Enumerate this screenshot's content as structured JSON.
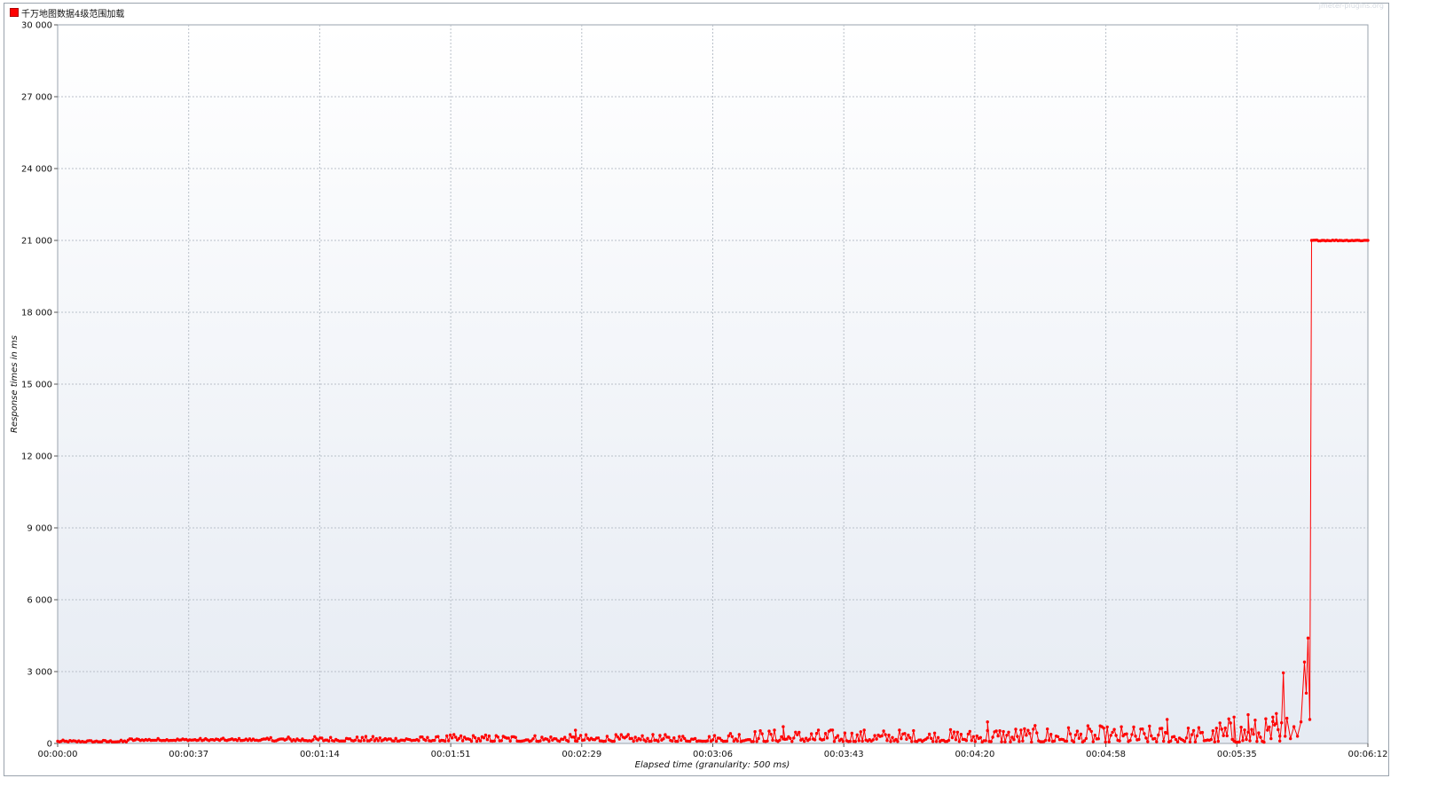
{
  "legend": {
    "label": "千万地图数据4级范围加载",
    "color": "#ff0000"
  },
  "watermark": "jmeter-plugins.org",
  "chart_data": {
    "type": "line",
    "xlabel": "Elapsed time (granularity: 500 ms)",
    "ylabel": "Response times in ms",
    "ylim": [
      0,
      30000
    ],
    "yticks": [
      "0",
      "3 000",
      "6 000",
      "9 000",
      "12 000",
      "15 000",
      "18 000",
      "21 000",
      "24 000",
      "27 000",
      "30 000"
    ],
    "xticks": [
      "00:00:00",
      "00:00:37",
      "00:01:14",
      "00:01:51",
      "00:02:29",
      "00:03:06",
      "00:03:43",
      "00:04:20",
      "00:04:58",
      "00:05:35",
      "00:06:12"
    ],
    "x_range_seconds": [
      0,
      372
    ],
    "granularity_ms": 500,
    "grid": true,
    "legend_position": "top-left",
    "series": [
      {
        "name": "千万地图数据4级范围加载",
        "color": "#ff0000",
        "segments": [
          {
            "from_s": 0,
            "to_s": 20,
            "min": 60,
            "max": 140
          },
          {
            "from_s": 20,
            "to_s": 60,
            "min": 120,
            "max": 220
          },
          {
            "from_s": 60,
            "to_s": 110,
            "min": 100,
            "max": 300
          },
          {
            "from_s": 110,
            "to_s": 190,
            "min": 90,
            "max": 380
          },
          {
            "from_s": 190,
            "to_s": 260,
            "min": 80,
            "max": 600
          },
          {
            "from_s": 260,
            "to_s": 330,
            "min": 60,
            "max": 750
          },
          {
            "from_s": 330,
            "to_s": 348,
            "min": 50,
            "max": 1100
          }
        ],
        "points": [
          {
            "x": 147,
            "y": 550
          },
          {
            "x": 206,
            "y": 700
          },
          {
            "x": 264,
            "y": 900
          },
          {
            "x": 315,
            "y": 1000
          },
          {
            "x": 334,
            "y": 1100
          },
          {
            "x": 338,
            "y": 1200
          },
          {
            "x": 345,
            "y": 1100
          },
          {
            "x": 346,
            "y": 1250
          },
          {
            "x": 347,
            "y": 100
          },
          {
            "x": 348,
            "y": 2950
          },
          {
            "x": 348.5,
            "y": 300
          },
          {
            "x": 349,
            "y": 1050
          },
          {
            "x": 350,
            "y": 200
          },
          {
            "x": 351,
            "y": 700
          },
          {
            "x": 352,
            "y": 300
          },
          {
            "x": 353,
            "y": 900
          },
          {
            "x": 354,
            "y": 3400
          },
          {
            "x": 354.5,
            "y": 2100
          },
          {
            "x": 355,
            "y": 4400
          },
          {
            "x": 355.5,
            "y": 1000
          },
          {
            "x": 356,
            "y": 21000
          },
          {
            "x": 372,
            "y": 21000
          }
        ]
      }
    ]
  }
}
